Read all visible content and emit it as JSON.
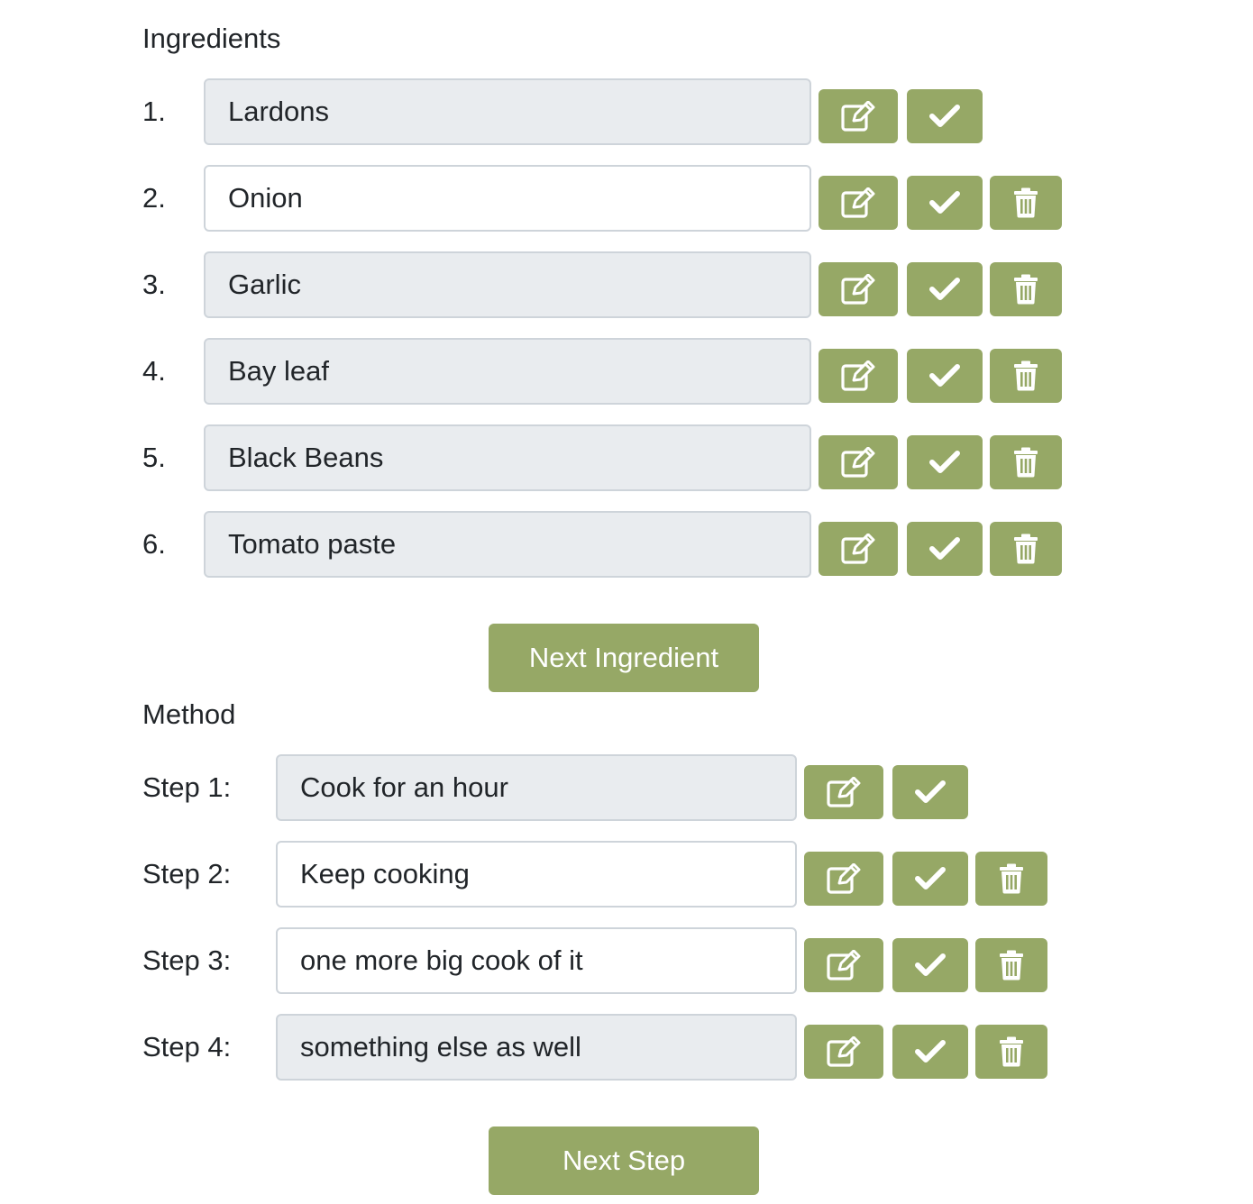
{
  "ingredients": {
    "heading": "Ingredients",
    "items": [
      {
        "label": "1.",
        "value": "Lardons",
        "editable": false,
        "deletable": false
      },
      {
        "label": "2.",
        "value": "Onion",
        "editable": true,
        "deletable": true
      },
      {
        "label": "3.",
        "value": "Garlic",
        "editable": false,
        "deletable": true
      },
      {
        "label": "4.",
        "value": "Bay leaf",
        "editable": false,
        "deletable": true
      },
      {
        "label": "5.",
        "value": "Black Beans",
        "editable": false,
        "deletable": true
      },
      {
        "label": "6.",
        "value": "Tomato paste",
        "editable": false,
        "deletable": true
      }
    ],
    "next_label": "Next Ingredient"
  },
  "method": {
    "heading": "Method",
    "items": [
      {
        "label": "Step 1:",
        "value": "Cook for an hour",
        "editable": false,
        "deletable": false
      },
      {
        "label": "Step 2:",
        "value": "Keep cooking",
        "editable": true,
        "deletable": true
      },
      {
        "label": "Step 3:",
        "value": "one more big cook of it",
        "editable": true,
        "deletable": true
      },
      {
        "label": "Step 4:",
        "value": "something else as well",
        "editable": false,
        "deletable": true
      }
    ],
    "next_label": "Next Step"
  },
  "icons": {
    "edit": "edit-icon",
    "check": "check-icon",
    "delete": "trash-icon"
  },
  "colors": {
    "accent": "#96a866",
    "readonly_bg": "#e9ecef",
    "border": "#ced4da",
    "text": "#212529"
  }
}
